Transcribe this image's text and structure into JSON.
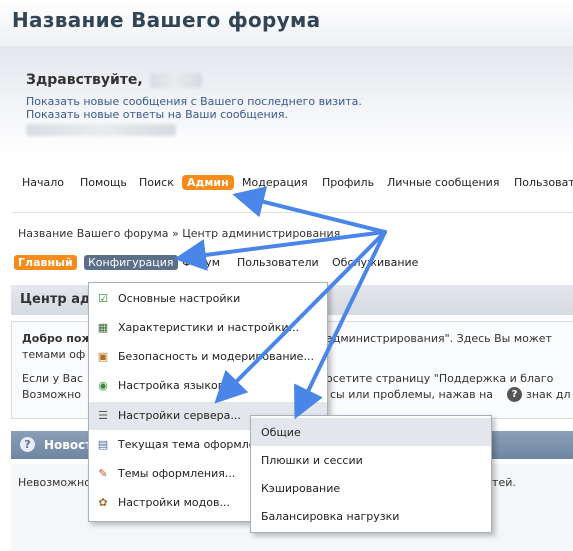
{
  "header": {
    "forum_title": "Название Вашего форума",
    "greeting": "Здравствуйте,",
    "link_new_posts": "Показать новые сообщения с Вашего последнего визита.",
    "link_your_replies": "Показать новые ответы на Ваши сообщения."
  },
  "nav": {
    "items": [
      "Начало",
      "Помощь",
      "Поиск",
      "Админ",
      "Модерация",
      "Профиль",
      "Личные сообщения",
      "Пользовате"
    ]
  },
  "breadcrumb": "Название Вашего форума » Центр администрирования",
  "admin_tabs": {
    "main": "Главный",
    "config": "Конфигурация",
    "forum": "Форум",
    "users": "Пользователи",
    "maintenance": "Обслуживание"
  },
  "panel": {
    "title": "Центр адм",
    "welcome_bold": "Добро пож",
    "welcome_rest": "администрирования\". Здесь Вы может",
    "line2": "темами оф",
    "line3a": "Если у Вас",
    "line3b": "осетите страницу \"Поддержка и благо",
    "line4a": "Возможно",
    "line4b": "сы или проблемы, нажав на",
    "line4c": "знак дл",
    "help_icon": "?"
  },
  "news": {
    "title": "Новост",
    "body_a": "Невозможно",
    "body_b": "стей."
  },
  "config_menu": {
    "items": [
      {
        "label": "Основные настройки",
        "icon": "checklist-icon"
      },
      {
        "label": "Характеристики и настройки...",
        "icon": "features-icon"
      },
      {
        "label": "Безопасность и модерирование...",
        "icon": "security-icon"
      },
      {
        "label": "Настройка языков...",
        "icon": "language-icon"
      },
      {
        "label": "Настройки сервера...",
        "icon": "server-icon"
      },
      {
        "label": "Текущая тема оформле",
        "icon": "theme-icon"
      },
      {
        "label": "Темы оформления...",
        "icon": "brush-icon"
      },
      {
        "label": "Настройки модов...",
        "icon": "mods-icon"
      }
    ]
  },
  "server_submenu": {
    "items": [
      "Общие",
      "Плюшки и сессии",
      "Кэширование",
      "Балансировка нагрузки"
    ]
  },
  "colors": {
    "accent_orange": "#f58b1a",
    "tab_blue": "#5b7088",
    "arrow_blue": "#4a86e8",
    "title": "#345566"
  }
}
